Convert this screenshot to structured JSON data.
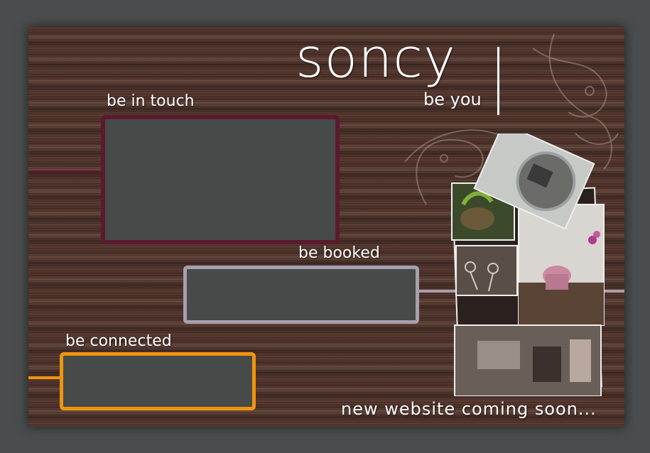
{
  "brand": {
    "name": "soncy",
    "tagline": "be you"
  },
  "sections": {
    "touch": {
      "label": "be in touch",
      "accent": "#5c1a2e"
    },
    "booked": {
      "label": "be booked",
      "accent": "#a89fae"
    },
    "connected": {
      "label": "be connected",
      "accent": "#f0940f"
    }
  },
  "footer": {
    "message": "new website coming soon..."
  },
  "colors": {
    "page_background": "#4a4d4d",
    "panel_fill": "#464b4a",
    "wood": "#503329"
  },
  "icons": [
    "swirl-ornament",
    "salon-photo-collage"
  ]
}
